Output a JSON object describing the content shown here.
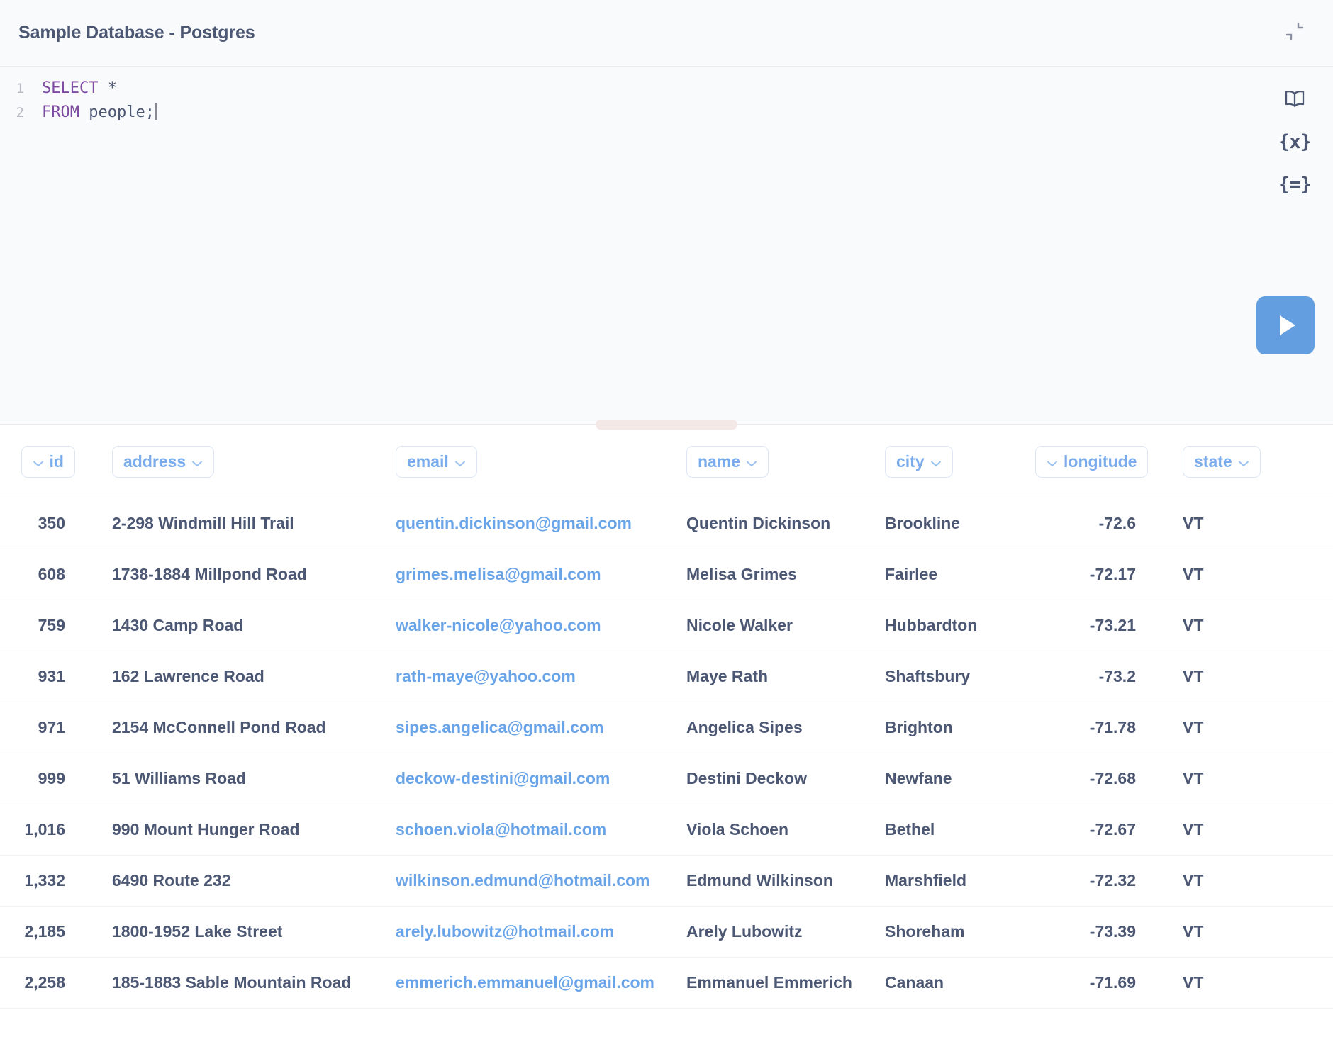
{
  "header": {
    "title": "Sample Database - Postgres",
    "collapse_icon": "collapse-arrows-icon"
  },
  "editor": {
    "lines": [
      {
        "number": "1",
        "keyword": "SELECT",
        "rest": " *"
      },
      {
        "number": "2",
        "keyword": "FROM",
        "rest": " people;"
      }
    ],
    "full_query": "SELECT *\nFROM people;",
    "rail": [
      {
        "name": "data-reference-icon",
        "label": ""
      },
      {
        "name": "variables-icon",
        "label": "{x}"
      },
      {
        "name": "snippets-icon",
        "label": "{=}"
      }
    ],
    "run_button": {
      "label": "",
      "color": "#629ee0",
      "icon": "play-icon"
    }
  },
  "results": {
    "columns": [
      {
        "key": "id",
        "label": "id",
        "align": "right",
        "chevron": "left"
      },
      {
        "key": "address",
        "label": "address",
        "align": "left",
        "chevron": "right"
      },
      {
        "key": "email",
        "label": "email",
        "align": "left",
        "chevron": "right"
      },
      {
        "key": "name",
        "label": "name",
        "align": "left",
        "chevron": "right"
      },
      {
        "key": "city",
        "label": "city",
        "align": "left",
        "chevron": "right"
      },
      {
        "key": "longitude",
        "label": "longitude",
        "align": "right",
        "chevron": "left"
      },
      {
        "key": "state",
        "label": "state",
        "align": "left",
        "chevron": "right"
      }
    ],
    "rows": [
      {
        "id": "350",
        "address": "2-298 Windmill Hill Trail",
        "email": "quentin.dickinson@gmail.com",
        "name": "Quentin Dickinson",
        "city": "Brookline",
        "longitude": "-72.6",
        "state": "VT"
      },
      {
        "id": "608",
        "address": "1738-1884 Millpond Road",
        "email": "grimes.melisa@gmail.com",
        "name": "Melisa Grimes",
        "city": "Fairlee",
        "longitude": "-72.17",
        "state": "VT"
      },
      {
        "id": "759",
        "address": "1430 Camp Road",
        "email": "walker-nicole@yahoo.com",
        "name": "Nicole Walker",
        "city": "Hubbardton",
        "longitude": "-73.21",
        "state": "VT"
      },
      {
        "id": "931",
        "address": "162 Lawrence Road",
        "email": "rath-maye@yahoo.com",
        "name": "Maye Rath",
        "city": "Shaftsbury",
        "longitude": "-73.2",
        "state": "VT"
      },
      {
        "id": "971",
        "address": "2154 McConnell Pond Road",
        "email": "sipes.angelica@gmail.com",
        "name": "Angelica Sipes",
        "city": "Brighton",
        "longitude": "-71.78",
        "state": "VT"
      },
      {
        "id": "999",
        "address": "51 Williams Road",
        "email": "deckow-destini@gmail.com",
        "name": "Destini Deckow",
        "city": "Newfane",
        "longitude": "-72.68",
        "state": "VT"
      },
      {
        "id": "1,016",
        "address": "990 Mount Hunger Road",
        "email": "schoen.viola@hotmail.com",
        "name": "Viola Schoen",
        "city": "Bethel",
        "longitude": "-72.67",
        "state": "VT"
      },
      {
        "id": "1,332",
        "address": "6490 Route 232",
        "email": "wilkinson.edmund@hotmail.com",
        "name": "Edmund Wilkinson",
        "city": "Marshfield",
        "longitude": "-72.32",
        "state": "VT"
      },
      {
        "id": "2,185",
        "address": "1800-1952 Lake Street",
        "email": "arely.lubowitz@hotmail.com",
        "name": "Arely Lubowitz",
        "city": "Shoreham",
        "longitude": "-73.39",
        "state": "VT"
      },
      {
        "id": "2,258",
        "address": "185-1883 Sable Mountain Road",
        "email": "emmerich.emmanuel@gmail.com",
        "name": "Emmanuel Emmerich",
        "city": "Canaan",
        "longitude": "-71.69",
        "state": "VT"
      }
    ]
  },
  "colors": {
    "accent_blue": "#629ee0",
    "link_blue": "#69a4e8",
    "header_pill_text": "#7aaced",
    "text_dark": "#4c5773",
    "keyword_purple": "#7d4ba0",
    "editor_bg": "#f9fafc",
    "drag_handle": "#f4e8e6"
  }
}
